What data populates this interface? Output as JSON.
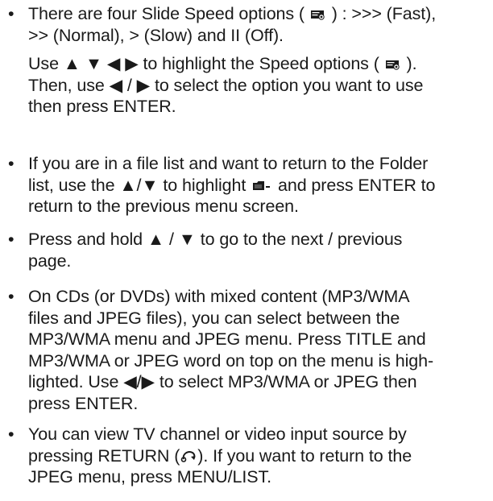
{
  "items": [
    {
      "paragraphs": [
        {
          "lines": [
            [
              "There are four Slide Speed options ( ",
              {
                "icon": "slide-speed-icon"
              },
              " ) : >>> (Fast),"
            ],
            [
              ">> (Normal), > (Slow) and II (Off)."
            ]
          ]
        },
        {
          "lines": [
            [
              "Use ▲ ▼ ◀ ▶ to highlight the Speed options ( ",
              {
                "icon": "slide-speed-icon"
              },
              " )."
            ],
            [
              "Then, use ◀ / ▶ to select the option you want to use"
            ],
            [
              "then press ENTER."
            ]
          ]
        }
      ]
    },
    {
      "paragraphs": [
        {
          "lines": [
            [
              "If you are in a file list and want to return to the Folder"
            ],
            [
              "list, use the ▲/▼ to highlight ",
              {
                "icon": "folder-up-icon"
              },
              " and press ENTER to"
            ],
            [
              "return to the previous menu screen."
            ]
          ]
        }
      ]
    },
    {
      "paragraphs": [
        {
          "lines": [
            [
              "Press and hold ▲ / ▼ to go to the next / previous"
            ],
            [
              "page."
            ]
          ]
        }
      ]
    },
    {
      "paragraphs": [
        {
          "lines": [
            [
              "On CDs (or DVDs) with mixed content (MP3/WMA"
            ],
            [
              "files and JPEG files), you can select between the"
            ],
            [
              "MP3/WMA menu and JPEG menu. Press TITLE and"
            ],
            [
              "MP3/WMA or JPEG word on top on the menu is high-"
            ],
            [
              "lighted. Use ◀/▶ to select MP3/WMA or JPEG then"
            ],
            [
              "press ENTER."
            ]
          ]
        }
      ]
    },
    {
      "paragraphs": [
        {
          "lines": [
            [
              "You can view TV channel or video input source by"
            ],
            [
              "pressing RETURN (",
              {
                "icon": "return-icon"
              },
              "). If you want to return to the"
            ],
            [
              "JPEG menu, press MENU/LIST."
            ]
          ]
        }
      ]
    }
  ],
  "bullet": "•",
  "colors": {
    "text": "#1a1a1a",
    "background": "#ffffff"
  }
}
